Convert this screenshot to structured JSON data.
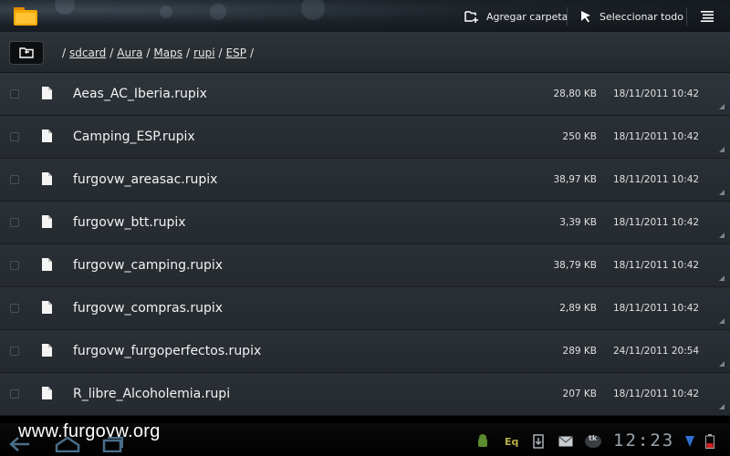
{
  "app": {
    "icon": "folder-icon"
  },
  "toolbar": {
    "new_folder_label": "Agregar carpeta",
    "new_folder_icon": "add-folder-icon",
    "select_all_label": "Seleccionar todo",
    "select_all_icon": "pointer-arrow-icon",
    "overflow_icon": "overflow-menu-icon"
  },
  "path": {
    "up_icon": "folder-up-icon",
    "crumbs": [
      "sdcard",
      "Aura",
      "Maps",
      "rupi",
      "ESP"
    ]
  },
  "files": [
    {
      "name": "Aeas_AC_Iberia.rupix",
      "size": "28,80 KB",
      "date": "18/11/2011 10:42"
    },
    {
      "name": "Camping_ESP.rupix",
      "size": "250 KB",
      "date": "18/11/2011 10:42"
    },
    {
      "name": "furgovw_areasac.rupix",
      "size": "38,97 KB",
      "date": "18/11/2011 10:42"
    },
    {
      "name": "furgovw_btt.rupix",
      "size": "3,39 KB",
      "date": "18/11/2011 10:42"
    },
    {
      "name": "furgovw_camping.rupix",
      "size": "38,79 KB",
      "date": "18/11/2011 10:42"
    },
    {
      "name": "furgovw_compras.rupix",
      "size": "2,89 KB",
      "date": "18/11/2011 10:42"
    },
    {
      "name": "furgovw_furgoperfectos.rupix",
      "size": "289 KB",
      "date": "24/11/2011 20:54"
    },
    {
      "name": "R_libre_Alcoholemia.rupi",
      "size": "207 KB",
      "date": "18/11/2011 10:42"
    }
  ],
  "watermark": "www.furgovw.org",
  "status": {
    "clock": "12:23",
    "eq_label": "Eq",
    "tk_label": "tk"
  },
  "colors": {
    "background": "#252a2f",
    "text": "#f2f2f2",
    "clock": "#9aa4ac"
  }
}
